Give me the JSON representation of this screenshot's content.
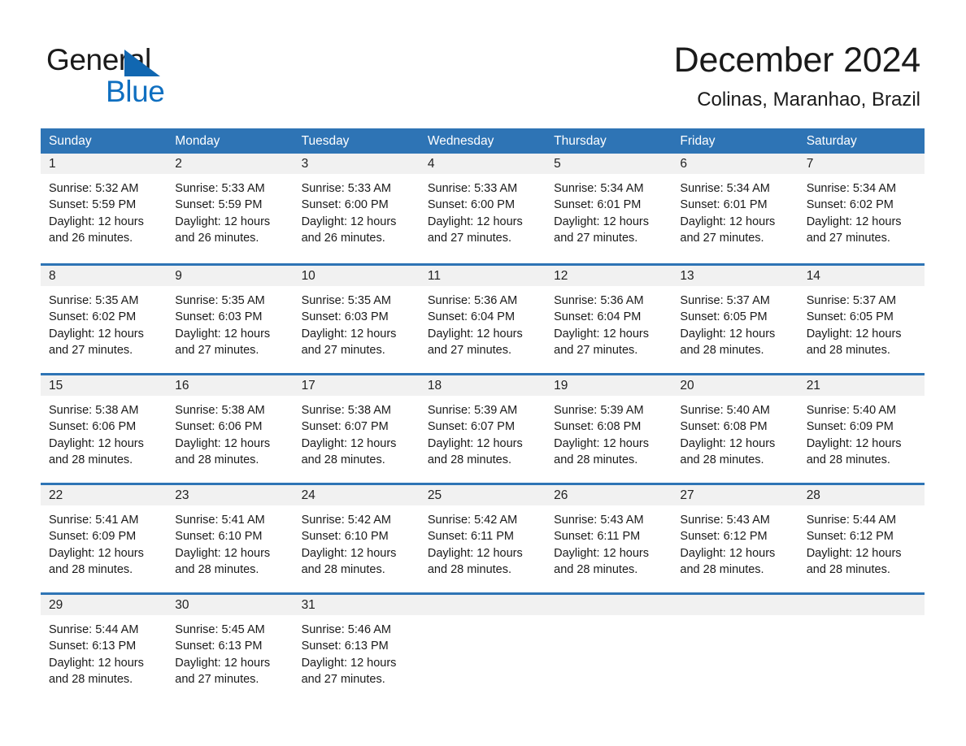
{
  "brand": {
    "word_one": "General",
    "word_two": "Blue",
    "triangle_icon": "brand-triangle-icon",
    "accent_color": "#1167b1"
  },
  "header": {
    "title": "December 2024",
    "subtitle": "Colinas, Maranhao, Brazil"
  },
  "colors": {
    "header_blue": "#2e74b5",
    "daynum_band": "#f1f1f1",
    "text": "#1a1a1a",
    "header_text": "#ffffff"
  },
  "weekdays": [
    "Sunday",
    "Monday",
    "Tuesday",
    "Wednesday",
    "Thursday",
    "Friday",
    "Saturday"
  ],
  "weeks": [
    [
      {
        "day": "1",
        "details": "Sunrise: 5:32 AM\nSunset: 5:59 PM\nDaylight: 12 hours\nand 26 minutes."
      },
      {
        "day": "2",
        "details": "Sunrise: 5:33 AM\nSunset: 5:59 PM\nDaylight: 12 hours\nand 26 minutes."
      },
      {
        "day": "3",
        "details": "Sunrise: 5:33 AM\nSunset: 6:00 PM\nDaylight: 12 hours\nand 26 minutes."
      },
      {
        "day": "4",
        "details": "Sunrise: 5:33 AM\nSunset: 6:00 PM\nDaylight: 12 hours\nand 27 minutes."
      },
      {
        "day": "5",
        "details": "Sunrise: 5:34 AM\nSunset: 6:01 PM\nDaylight: 12 hours\nand 27 minutes."
      },
      {
        "day": "6",
        "details": "Sunrise: 5:34 AM\nSunset: 6:01 PM\nDaylight: 12 hours\nand 27 minutes."
      },
      {
        "day": "7",
        "details": "Sunrise: 5:34 AM\nSunset: 6:02 PM\nDaylight: 12 hours\nand 27 minutes."
      }
    ],
    [
      {
        "day": "8",
        "details": "Sunrise: 5:35 AM\nSunset: 6:02 PM\nDaylight: 12 hours\nand 27 minutes."
      },
      {
        "day": "9",
        "details": "Sunrise: 5:35 AM\nSunset: 6:03 PM\nDaylight: 12 hours\nand 27 minutes."
      },
      {
        "day": "10",
        "details": "Sunrise: 5:35 AM\nSunset: 6:03 PM\nDaylight: 12 hours\nand 27 minutes."
      },
      {
        "day": "11",
        "details": "Sunrise: 5:36 AM\nSunset: 6:04 PM\nDaylight: 12 hours\nand 27 minutes."
      },
      {
        "day": "12",
        "details": "Sunrise: 5:36 AM\nSunset: 6:04 PM\nDaylight: 12 hours\nand 27 minutes."
      },
      {
        "day": "13",
        "details": "Sunrise: 5:37 AM\nSunset: 6:05 PM\nDaylight: 12 hours\nand 28 minutes."
      },
      {
        "day": "14",
        "details": "Sunrise: 5:37 AM\nSunset: 6:05 PM\nDaylight: 12 hours\nand 28 minutes."
      }
    ],
    [
      {
        "day": "15",
        "details": "Sunrise: 5:38 AM\nSunset: 6:06 PM\nDaylight: 12 hours\nand 28 minutes."
      },
      {
        "day": "16",
        "details": "Sunrise: 5:38 AM\nSunset: 6:06 PM\nDaylight: 12 hours\nand 28 minutes."
      },
      {
        "day": "17",
        "details": "Sunrise: 5:38 AM\nSunset: 6:07 PM\nDaylight: 12 hours\nand 28 minutes."
      },
      {
        "day": "18",
        "details": "Sunrise: 5:39 AM\nSunset: 6:07 PM\nDaylight: 12 hours\nand 28 minutes."
      },
      {
        "day": "19",
        "details": "Sunrise: 5:39 AM\nSunset: 6:08 PM\nDaylight: 12 hours\nand 28 minutes."
      },
      {
        "day": "20",
        "details": "Sunrise: 5:40 AM\nSunset: 6:08 PM\nDaylight: 12 hours\nand 28 minutes."
      },
      {
        "day": "21",
        "details": "Sunrise: 5:40 AM\nSunset: 6:09 PM\nDaylight: 12 hours\nand 28 minutes."
      }
    ],
    [
      {
        "day": "22",
        "details": "Sunrise: 5:41 AM\nSunset: 6:09 PM\nDaylight: 12 hours\nand 28 minutes."
      },
      {
        "day": "23",
        "details": "Sunrise: 5:41 AM\nSunset: 6:10 PM\nDaylight: 12 hours\nand 28 minutes."
      },
      {
        "day": "24",
        "details": "Sunrise: 5:42 AM\nSunset: 6:10 PM\nDaylight: 12 hours\nand 28 minutes."
      },
      {
        "day": "25",
        "details": "Sunrise: 5:42 AM\nSunset: 6:11 PM\nDaylight: 12 hours\nand 28 minutes."
      },
      {
        "day": "26",
        "details": "Sunrise: 5:43 AM\nSunset: 6:11 PM\nDaylight: 12 hours\nand 28 minutes."
      },
      {
        "day": "27",
        "details": "Sunrise: 5:43 AM\nSunset: 6:12 PM\nDaylight: 12 hours\nand 28 minutes."
      },
      {
        "day": "28",
        "details": "Sunrise: 5:44 AM\nSunset: 6:12 PM\nDaylight: 12 hours\nand 28 minutes."
      }
    ],
    [
      {
        "day": "29",
        "details": "Sunrise: 5:44 AM\nSunset: 6:13 PM\nDaylight: 12 hours\nand 28 minutes."
      },
      {
        "day": "30",
        "details": "Sunrise: 5:45 AM\nSunset: 6:13 PM\nDaylight: 12 hours\nand 27 minutes."
      },
      {
        "day": "31",
        "details": "Sunrise: 5:46 AM\nSunset: 6:13 PM\nDaylight: 12 hours\nand 27 minutes."
      },
      {
        "day": "",
        "details": ""
      },
      {
        "day": "",
        "details": ""
      },
      {
        "day": "",
        "details": ""
      },
      {
        "day": "",
        "details": ""
      }
    ]
  ]
}
